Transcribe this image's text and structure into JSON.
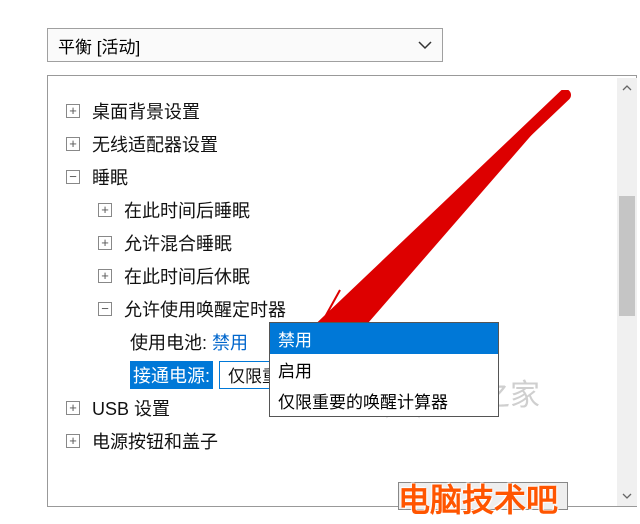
{
  "plan_selector": {
    "label": "平衡 [活动]"
  },
  "tree": {
    "desktop_bg": "桌面背景设置",
    "wireless": "无线适配器设置",
    "sleep": "睡眠",
    "sleep_after": "在此时间后睡眠",
    "allow_hybrid": "允许混合睡眠",
    "hibernate_after": "在此时间后休眠",
    "wake_timers": "允许使用唤醒定时器",
    "battery_label": "使用电池:",
    "battery_value": "禁用",
    "powered_label": "接通电源:",
    "powered_value": "仅限重要的唤醒计算器",
    "usb": "USB 设置",
    "power_buttons": "电源按钮和盖子"
  },
  "dropdown": {
    "options": [
      "禁用",
      "启用",
      "仅限重要的唤醒计算器"
    ],
    "selected_index": 0
  },
  "watermarks": {
    "w1": "装机之家",
    "w2": "电脑技术吧"
  }
}
